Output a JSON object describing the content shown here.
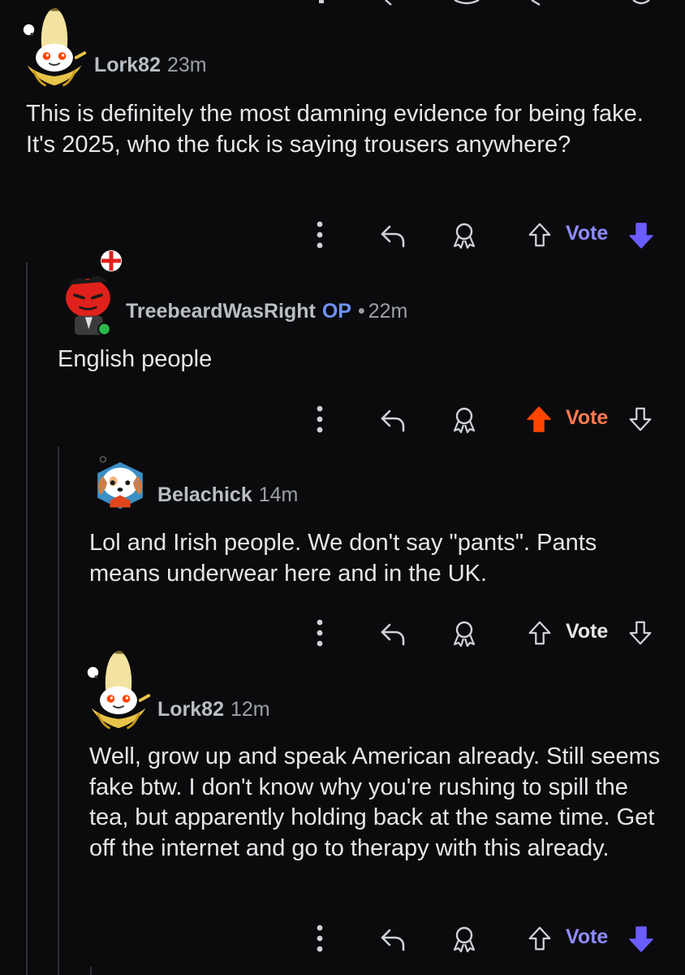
{
  "colors": {
    "background": "#0b0b0d",
    "upvote_active": "#ff4500",
    "downvote_active": "#6a5cff",
    "vote_label_neutral": "#e4e6e8",
    "vote_label_up": "#ff7a50",
    "vote_label_down": "#8f8cff",
    "op_badge": "#6f93f5",
    "online_dot": "#2bb84a"
  },
  "comments": [
    {
      "username": "Lork82",
      "time": "23m",
      "avatar": "banana-avatar-icon",
      "text": "This is definitely the most damning evidence for being fake. It's 2025, who the fuck is saying trousers anywhere?",
      "actions": {
        "more": "more-options-icon",
        "reply": "reply-icon",
        "award": "award-icon",
        "vote_label": "Vote",
        "vote_state": "downvoted"
      }
    },
    {
      "username": "TreebeardWasRight",
      "op_badge": "OP",
      "separator": "•",
      "time": "22m",
      "avatar": "red-snoo-avatar-icon",
      "text": "English people",
      "actions": {
        "more": "more-options-icon",
        "reply": "reply-icon",
        "award": "award-icon",
        "vote_label": "Vote",
        "vote_state": "upvoted"
      }
    },
    {
      "username": "Belachick",
      "time": "14m",
      "avatar": "puppy-avatar-icon",
      "text": "Lol and Irish people. We don't say \"pants\". Pants means underwear here and in the UK.",
      "actions": {
        "more": "more-options-icon",
        "reply": "reply-icon",
        "award": "award-icon",
        "vote_label": "Vote",
        "vote_state": "none"
      }
    },
    {
      "username": "Lork82",
      "time": "12m",
      "avatar": "banana-avatar-icon",
      "text": "Well, grow up and speak American already. Still seems fake btw. I don't know why you're rushing to spill the tea, but apparently holding back at the same time. Get off the internet and go to therapy with this already.",
      "actions": {
        "more": "more-options-icon",
        "reply": "reply-icon",
        "award": "award-icon",
        "vote_label": "Vote",
        "vote_state": "downvoted"
      }
    }
  ]
}
